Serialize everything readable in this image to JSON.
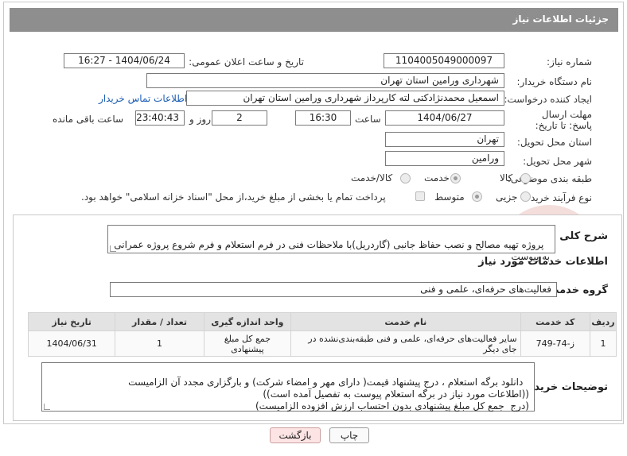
{
  "title": "جزئیات اطلاعات نیاز",
  "fields": {
    "need_number_label": "شماره نیاز:",
    "need_number": "1104005049000097",
    "announce_label": "تاریخ و ساعت اعلان عمومی:",
    "announce_value": "1404/06/24 - 16:27",
    "buyer_org_label": "نام دستگاه خریدار:",
    "buyer_org": "شهرداری ورامین استان تهران",
    "creator_label": "ایجاد کننده درخواست:",
    "creator": "اسمعیل محمدنژادکتی لته کارپرداز شهرداری ورامین استان تهران",
    "contact_link": "اطلاعات تماس خریدار",
    "deadline_label": "مهلت ارسال پاسخ: تا تاریخ:",
    "deadline_date": "1404/06/27",
    "time_label": "ساعت",
    "deadline_time": "16:30",
    "days_value": "2",
    "days_label": "روز و",
    "remaining_time": "23:40:43",
    "remaining_label": "ساعت باقی مانده",
    "province_label": "استان محل تحویل:",
    "province": "تهران",
    "city_label": "شهر محل تحویل:",
    "city": "ورامین",
    "category_label": "طبقه بندی موضوعی:",
    "category_options": [
      "کالا",
      "خدمت",
      "کالا/خدمت"
    ],
    "process_label": "نوع فرآیند خرید :",
    "process_options": [
      "جزیی",
      "متوسط"
    ],
    "payment_note": "پرداخت تمام یا بخشی از مبلغ خرید،از محل \"اسناد خزانه اسلامی\" خواهد بود."
  },
  "section2": {
    "summary_label": "شرح کلی نیاز:",
    "summary": "پروژه تهیه مصالح و نصب حفاظ جانبی (گاردریل)با ملاحظات فنی در فرم استعلام و فرم شروع پروژه عمرانی به پیوست",
    "services_heading": "اطلاعات خدمات مورد نیاز",
    "service_group_label": "گروه خدمت:",
    "service_group": "فعالیت‌های حرفه‌ای، علمی و فنی",
    "table": {
      "headers": [
        "ردیف",
        "کد خدمت",
        "نام خدمت",
        "واحد اندازه گیری",
        "تعداد / مقدار",
        "تاریخ نیاز"
      ],
      "rows": [
        [
          "1",
          "ز-74-749",
          "سایر فعالیت‌های حرفه‌ای، علمی و فنی طبقه‌بندی‌نشده در جای دیگر",
          "جمع کل مبلغ پیشنهادی",
          "1",
          "1404/06/31"
        ]
      ]
    },
    "buyer_notes_label": "توضیحات خریدار:",
    "buyer_notes": "دانلود برگه استعلام ، درج پیشنهاد قیمت( دارای مهر و امضاء شرکت) و بارگزاری مجدد آن الزامیست\n((اطلاعات مورد نیاز در برگه استعلام پیوست به تفصیل آمده است))\n(درج  جمع کل مبلغ پیشنهادی بدون احتساب ارزش افزوده الزامیست)"
  },
  "buttons": {
    "print": "چاپ",
    "back": "بازگشت"
  },
  "watermark_text": "AriaTender.neT"
}
